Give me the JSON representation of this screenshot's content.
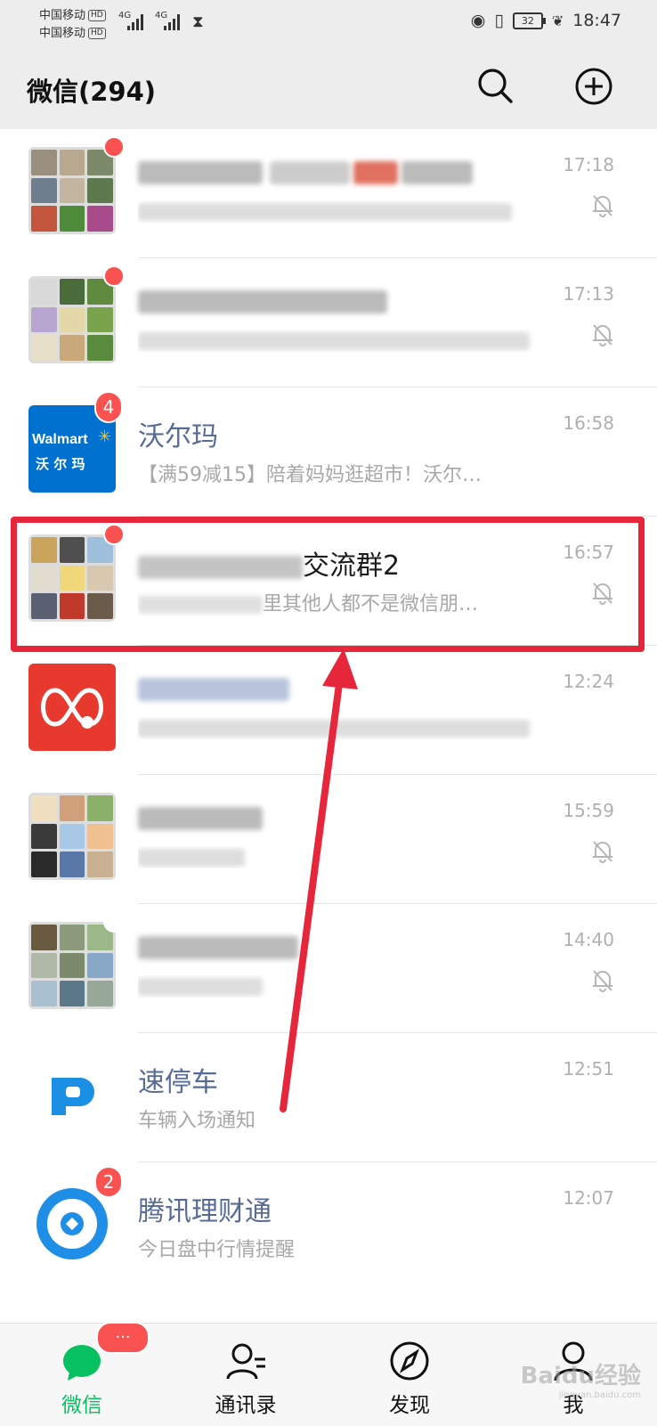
{
  "status_bar": {
    "carrier_1": "中国移动",
    "carrier_2": "中国移动",
    "hd_label": "HD",
    "network_1": "4G",
    "network_2": "4G",
    "battery": "32",
    "time": "18:47"
  },
  "header": {
    "title": "微信(294)",
    "search_icon": "search-icon",
    "add_icon": "plus-circle-icon"
  },
  "chats": [
    {
      "name": "",
      "preview": "",
      "time": "17:18",
      "muted": true,
      "unread_dot": true
    },
    {
      "name": "",
      "preview": "",
      "time": "17:13",
      "muted": true,
      "unread_dot": true
    },
    {
      "name": "沃尔玛",
      "preview": "【满59减15】陪着妈妈逛超市！沃尔…",
      "time": "16:58",
      "muted": false,
      "badge": "4",
      "avatar_text": "Walmart",
      "avatar_subtext": "沃 尔 玛"
    },
    {
      "name_suffix": "交流群2",
      "preview_suffix": "里其他人都不是微信朋…",
      "time": "16:57",
      "muted": true,
      "unread_dot": true
    },
    {
      "name": "",
      "preview": "",
      "time": "12:24",
      "muted": false
    },
    {
      "name": "",
      "preview": "",
      "time": "15:59",
      "muted": true
    },
    {
      "name": "",
      "preview": "",
      "time": "14:40",
      "muted": true,
      "unread_dot": true
    },
    {
      "name": "速停车",
      "preview": "车辆入场通知",
      "time": "12:51",
      "muted": false
    },
    {
      "name": "腾讯理财通",
      "preview": "今日盘中行情提醒",
      "time": "12:07",
      "muted": false,
      "badge": "2"
    }
  ],
  "tabbar": {
    "tabs": [
      {
        "label": "微信",
        "icon": "chat-bubble-icon",
        "active": true,
        "badge": "···"
      },
      {
        "label": "通讯录",
        "icon": "contacts-icon",
        "active": false
      },
      {
        "label": "发现",
        "icon": "compass-icon",
        "active": false
      },
      {
        "label": "我",
        "icon": "person-icon",
        "active": false
      }
    ]
  },
  "watermark": {
    "text": "Baidu经验",
    "subtext": "jingyan.baidu.com"
  },
  "colors": {
    "accent_green": "#07c160",
    "badge_red": "#fa5151",
    "highlight_red": "#e6263b",
    "link_blue": "#576b95"
  }
}
